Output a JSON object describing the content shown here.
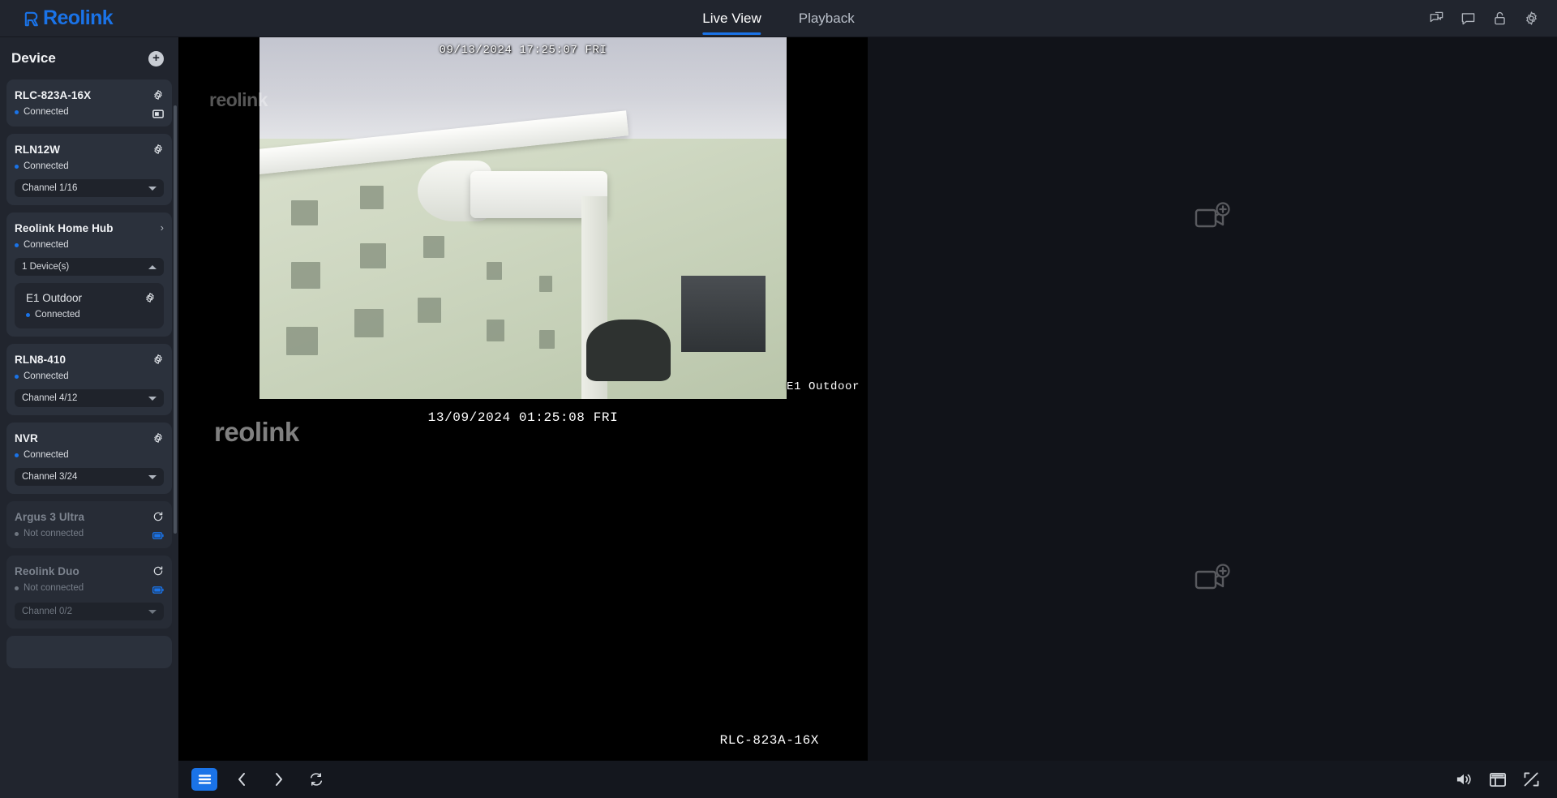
{
  "app": {
    "brand": "Reolink",
    "accent_color": "#1a73e8",
    "header_bg": "#21252e",
    "sidebar_bg": "#21252e",
    "card_bg": "#2b313c",
    "stage_bg": "#14171e"
  },
  "header": {
    "tabs": [
      {
        "label": "Live View",
        "active": true
      },
      {
        "label": "Playback",
        "active": false
      }
    ],
    "icons": [
      {
        "name": "two-way-talk-icon",
        "title": "Two-Way Talk"
      },
      {
        "name": "message-icon",
        "title": "Messages"
      },
      {
        "name": "unlock-icon",
        "title": "Lock"
      },
      {
        "name": "gear-icon",
        "title": "Settings"
      }
    ]
  },
  "sidebar": {
    "title": "Device",
    "add_label": "+",
    "devices": [
      {
        "name": "RLC-823A-16X",
        "status": "Connected",
        "connected": true,
        "has_channel": false,
        "channel": "",
        "icons": [
          "gear-icon",
          "snapshot-icon"
        ],
        "expander": ""
      },
      {
        "name": "RLN12W",
        "status": "Connected",
        "connected": true,
        "has_channel": true,
        "channel": "Channel 1/16",
        "icons": [
          "gear-icon"
        ],
        "expander": "down"
      },
      {
        "name": "Reolink Home Hub",
        "status": "Connected",
        "connected": true,
        "has_channel": true,
        "channel": "1 Device(s)",
        "icons": [
          "chevron-right-icon"
        ],
        "expander": "up",
        "children": [
          {
            "name": "E1 Outdoor",
            "status": "Connected",
            "connected": true,
            "icons": [
              "gear-icon"
            ]
          }
        ]
      },
      {
        "name": "RLN8-410",
        "status": "Connected",
        "connected": true,
        "has_channel": true,
        "channel": "Channel 4/12",
        "icons": [
          "gear-icon"
        ],
        "expander": "down"
      },
      {
        "name": "NVR",
        "status": "Connected",
        "connected": true,
        "has_channel": true,
        "channel": "Channel 3/24",
        "icons": [
          "gear-icon"
        ],
        "expander": "down"
      },
      {
        "name": "Argus 3 Ultra",
        "status": "Not connected",
        "connected": false,
        "has_channel": false,
        "channel": "",
        "icons": [
          "refresh-icon",
          "battery-icon"
        ],
        "expander": ""
      },
      {
        "name": "Reolink Duo",
        "status": "Not connected",
        "connected": false,
        "has_channel": true,
        "channel": "Channel 0/2",
        "icons": [
          "refresh-icon",
          "battery-icon"
        ],
        "expander": "down"
      }
    ]
  },
  "grid": {
    "layout": "2x2",
    "tiles": [
      {
        "id": "tile-1",
        "state": "live",
        "selected": true,
        "timestamp": "09/13/2024 17:25:07 FRI",
        "camera_label": "E1 Outdoor",
        "watermark": "reolink"
      },
      {
        "id": "tile-2",
        "state": "empty",
        "selected": false,
        "placeholder_icon": "add-camera-icon"
      },
      {
        "id": "tile-3",
        "state": "live",
        "selected": false,
        "timestamp": "13/09/2024 01:25:08 FRI",
        "camera_label": "RLC-823A-16X",
        "watermark": "reolink"
      },
      {
        "id": "tile-4",
        "state": "empty",
        "selected": false,
        "placeholder_icon": "add-camera-icon"
      }
    ]
  },
  "toolbar": {
    "left": [
      {
        "name": "layout-button",
        "icon": "layout-icon",
        "active": true
      },
      {
        "name": "previous-button",
        "icon": "chevron-left-icon",
        "active": false
      },
      {
        "name": "next-button",
        "icon": "chevron-right-icon",
        "active": false
      },
      {
        "name": "refresh-button",
        "icon": "refresh-icon",
        "active": false
      }
    ],
    "right": [
      {
        "name": "volume-button",
        "icon": "speaker-icon"
      },
      {
        "name": "grid-layout-button",
        "icon": "grid-icon"
      },
      {
        "name": "fullscreen-button",
        "icon": "fullscreen-icon"
      }
    ]
  }
}
